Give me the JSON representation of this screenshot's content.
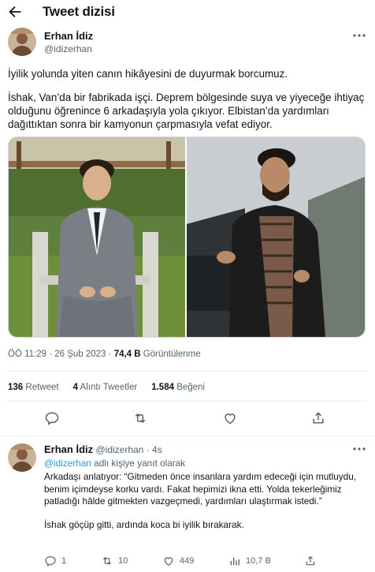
{
  "header": {
    "title": "Tweet dizisi"
  },
  "tweet": {
    "author": {
      "name": "Erhan İdiz",
      "handle": "@idizerhan"
    },
    "paragraphs": [
      "İyilik yolunda yiten canın hikâyesini de duyurmak borcumuz.",
      "İshak, Van’da bir fabrikada işçi. Deprem bölgesinde suya ve yiyeceğe ihtiyaç olduğunu öğrenince 6 arkadaşıyla yola çıkıyor. Elbistan’da yardımları dağıttıktan sonra bir kamyonun çarpmasıyla vefat ediyor."
    ],
    "time": "ÖÖ 11:29 · 26 Şub 2023 · ",
    "views_count": "74,4 B",
    "views_label": "Görüntülenme",
    "retweets_count": "136",
    "retweets_label": "Retweet",
    "quotes_count": "4",
    "quotes_label": "Alıntı Tweetler",
    "likes_count": "1.584",
    "likes_label": "Beğeni"
  },
  "reply": {
    "author": {
      "name": "Erhan İdiz",
      "handle": "@idizerhan",
      "time": "· 4s"
    },
    "replying_to_handle": "@idizerhan",
    "replying_to_suffix": " adlı kişiye yanıt olarak",
    "paragraphs": [
      "Arkadaşı anlatıyor: “Gitmeden önce insanlara yardım edeceği için mutluydu, benim içimdeyse korku vardı. Fakat hepimizi ikna etti. Yolda tekerleğimiz patladığı hâlde gitmekten vazgeçmedi, yardımları ulaştırmak istedi.”",
      "İshak göçüp gitti, ardında koca bi iyilik bırakarak."
    ],
    "stats": {
      "replies": "1",
      "retweets": "10",
      "likes": "449",
      "views": "10,7 B"
    }
  },
  "colors": {
    "accent": "#1d9bf0",
    "text": "#0f1419",
    "muted": "#536471",
    "border": "#e6ecf0"
  },
  "icons": [
    "arrow-left-icon",
    "more-icon",
    "reply-icon",
    "retweet-icon",
    "like-icon",
    "share-icon",
    "views-icon"
  ]
}
